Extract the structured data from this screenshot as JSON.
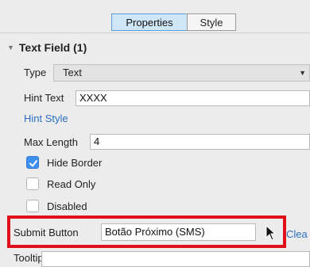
{
  "tabs": [
    {
      "label": "Properties",
      "active": true
    },
    {
      "label": "Style",
      "active": false
    }
  ],
  "section": {
    "title": "Text Field (1)",
    "icon": "disclosure-triangle-icon"
  },
  "type": {
    "label": "Type",
    "value": "Text"
  },
  "hint_text": {
    "label": "Hint Text",
    "value": "XXXX"
  },
  "hint_style": {
    "label": "Hint Style"
  },
  "max_length": {
    "label": "Max Length",
    "value": "4"
  },
  "checks": [
    {
      "label": "Hide Border",
      "checked": true
    },
    {
      "label": "Read Only",
      "checked": false
    },
    {
      "label": "Disabled",
      "checked": false
    }
  ],
  "submit_button": {
    "label": "Submit Button",
    "value": "Botão Próximo (SMS)"
  },
  "clear_link": "Clea",
  "tooltip": {
    "label": "Tooltip"
  },
  "colors": {
    "accent": "#3d8ff0",
    "link": "#2b6fc0",
    "highlight": "#e0101a"
  }
}
